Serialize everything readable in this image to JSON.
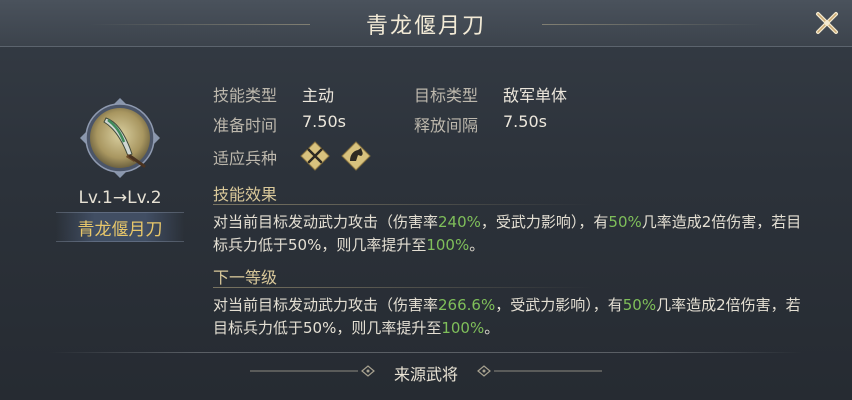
{
  "dialog": {
    "title": "青龙偃月刀"
  },
  "skill": {
    "level": "Lv.1→Lv.2",
    "name": "青龙偃月刀",
    "icon": "green-dragon-crescent-blade-icon"
  },
  "info": {
    "skill_type_label": "技能类型",
    "skill_type_value": "主动",
    "target_type_label": "目标类型",
    "target_type_value": "敌军单体",
    "prep_time_label": "准备时间",
    "prep_time_value": "7.50s",
    "cast_interval_label": "释放间隔",
    "cast_interval_value": "7.50s",
    "troop_label": "适应兵种",
    "troop_icons": [
      "crossed-swords-icon",
      "cavalry-icon"
    ]
  },
  "effect": {
    "title": "技能效果",
    "seg1": "对当前目标发动武力攻击（伤害率",
    "rate": "240%",
    "seg2": "，受武力影响），有",
    "chance": "50%",
    "seg3": "几率造成2倍伤害，若目标兵力低于50%，则几率提升至",
    "boost": "100%",
    "seg4": "。"
  },
  "next_level": {
    "title": "下一等级",
    "seg1": "对当前目标发动武力攻击（伤害率",
    "rate": "266.6%",
    "seg2": "，受武力影响），有",
    "chance": "50%",
    "seg3": "几率造成2倍伤害，若目标兵力低于50%，则几率提升至",
    "boost": "100%",
    "seg4": "。"
  },
  "footer": {
    "source_label": "来源武将"
  },
  "colors": {
    "highlight": "#7fbf5a",
    "gold": "#e8c76a"
  }
}
